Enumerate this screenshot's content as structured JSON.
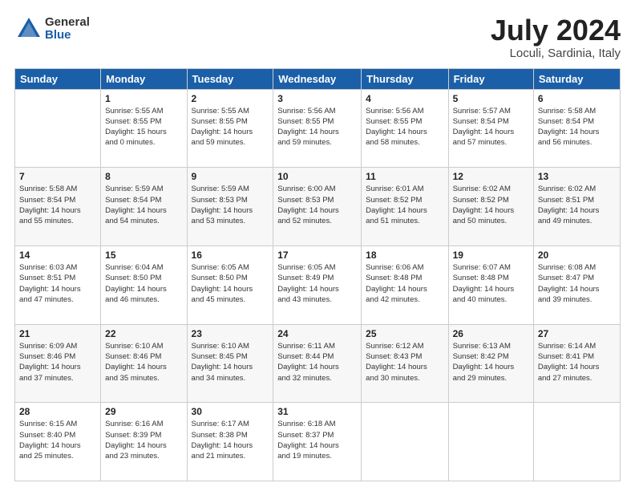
{
  "header": {
    "logo": {
      "general": "General",
      "blue": "Blue"
    },
    "title": "July 2024",
    "location": "Loculi, Sardinia, Italy"
  },
  "days_header": [
    "Sunday",
    "Monday",
    "Tuesday",
    "Wednesday",
    "Thursday",
    "Friday",
    "Saturday"
  ],
  "weeks": [
    [
      {
        "day": "",
        "info": ""
      },
      {
        "day": "1",
        "info": "Sunrise: 5:55 AM\nSunset: 8:55 PM\nDaylight: 15 hours\nand 0 minutes."
      },
      {
        "day": "2",
        "info": "Sunrise: 5:55 AM\nSunset: 8:55 PM\nDaylight: 14 hours\nand 59 minutes."
      },
      {
        "day": "3",
        "info": "Sunrise: 5:56 AM\nSunset: 8:55 PM\nDaylight: 14 hours\nand 59 minutes."
      },
      {
        "day": "4",
        "info": "Sunrise: 5:56 AM\nSunset: 8:55 PM\nDaylight: 14 hours\nand 58 minutes."
      },
      {
        "day": "5",
        "info": "Sunrise: 5:57 AM\nSunset: 8:54 PM\nDaylight: 14 hours\nand 57 minutes."
      },
      {
        "day": "6",
        "info": "Sunrise: 5:58 AM\nSunset: 8:54 PM\nDaylight: 14 hours\nand 56 minutes."
      }
    ],
    [
      {
        "day": "7",
        "info": "Sunrise: 5:58 AM\nSunset: 8:54 PM\nDaylight: 14 hours\nand 55 minutes."
      },
      {
        "day": "8",
        "info": "Sunrise: 5:59 AM\nSunset: 8:54 PM\nDaylight: 14 hours\nand 54 minutes."
      },
      {
        "day": "9",
        "info": "Sunrise: 5:59 AM\nSunset: 8:53 PM\nDaylight: 14 hours\nand 53 minutes."
      },
      {
        "day": "10",
        "info": "Sunrise: 6:00 AM\nSunset: 8:53 PM\nDaylight: 14 hours\nand 52 minutes."
      },
      {
        "day": "11",
        "info": "Sunrise: 6:01 AM\nSunset: 8:52 PM\nDaylight: 14 hours\nand 51 minutes."
      },
      {
        "day": "12",
        "info": "Sunrise: 6:02 AM\nSunset: 8:52 PM\nDaylight: 14 hours\nand 50 minutes."
      },
      {
        "day": "13",
        "info": "Sunrise: 6:02 AM\nSunset: 8:51 PM\nDaylight: 14 hours\nand 49 minutes."
      }
    ],
    [
      {
        "day": "14",
        "info": "Sunrise: 6:03 AM\nSunset: 8:51 PM\nDaylight: 14 hours\nand 47 minutes."
      },
      {
        "day": "15",
        "info": "Sunrise: 6:04 AM\nSunset: 8:50 PM\nDaylight: 14 hours\nand 46 minutes."
      },
      {
        "day": "16",
        "info": "Sunrise: 6:05 AM\nSunset: 8:50 PM\nDaylight: 14 hours\nand 45 minutes."
      },
      {
        "day": "17",
        "info": "Sunrise: 6:05 AM\nSunset: 8:49 PM\nDaylight: 14 hours\nand 43 minutes."
      },
      {
        "day": "18",
        "info": "Sunrise: 6:06 AM\nSunset: 8:48 PM\nDaylight: 14 hours\nand 42 minutes."
      },
      {
        "day": "19",
        "info": "Sunrise: 6:07 AM\nSunset: 8:48 PM\nDaylight: 14 hours\nand 40 minutes."
      },
      {
        "day": "20",
        "info": "Sunrise: 6:08 AM\nSunset: 8:47 PM\nDaylight: 14 hours\nand 39 minutes."
      }
    ],
    [
      {
        "day": "21",
        "info": "Sunrise: 6:09 AM\nSunset: 8:46 PM\nDaylight: 14 hours\nand 37 minutes."
      },
      {
        "day": "22",
        "info": "Sunrise: 6:10 AM\nSunset: 8:46 PM\nDaylight: 14 hours\nand 35 minutes."
      },
      {
        "day": "23",
        "info": "Sunrise: 6:10 AM\nSunset: 8:45 PM\nDaylight: 14 hours\nand 34 minutes."
      },
      {
        "day": "24",
        "info": "Sunrise: 6:11 AM\nSunset: 8:44 PM\nDaylight: 14 hours\nand 32 minutes."
      },
      {
        "day": "25",
        "info": "Sunrise: 6:12 AM\nSunset: 8:43 PM\nDaylight: 14 hours\nand 30 minutes."
      },
      {
        "day": "26",
        "info": "Sunrise: 6:13 AM\nSunset: 8:42 PM\nDaylight: 14 hours\nand 29 minutes."
      },
      {
        "day": "27",
        "info": "Sunrise: 6:14 AM\nSunset: 8:41 PM\nDaylight: 14 hours\nand 27 minutes."
      }
    ],
    [
      {
        "day": "28",
        "info": "Sunrise: 6:15 AM\nSunset: 8:40 PM\nDaylight: 14 hours\nand 25 minutes."
      },
      {
        "day": "29",
        "info": "Sunrise: 6:16 AM\nSunset: 8:39 PM\nDaylight: 14 hours\nand 23 minutes."
      },
      {
        "day": "30",
        "info": "Sunrise: 6:17 AM\nSunset: 8:38 PM\nDaylight: 14 hours\nand 21 minutes."
      },
      {
        "day": "31",
        "info": "Sunrise: 6:18 AM\nSunset: 8:37 PM\nDaylight: 14 hours\nand 19 minutes."
      },
      {
        "day": "",
        "info": ""
      },
      {
        "day": "",
        "info": ""
      },
      {
        "day": "",
        "info": ""
      }
    ]
  ]
}
